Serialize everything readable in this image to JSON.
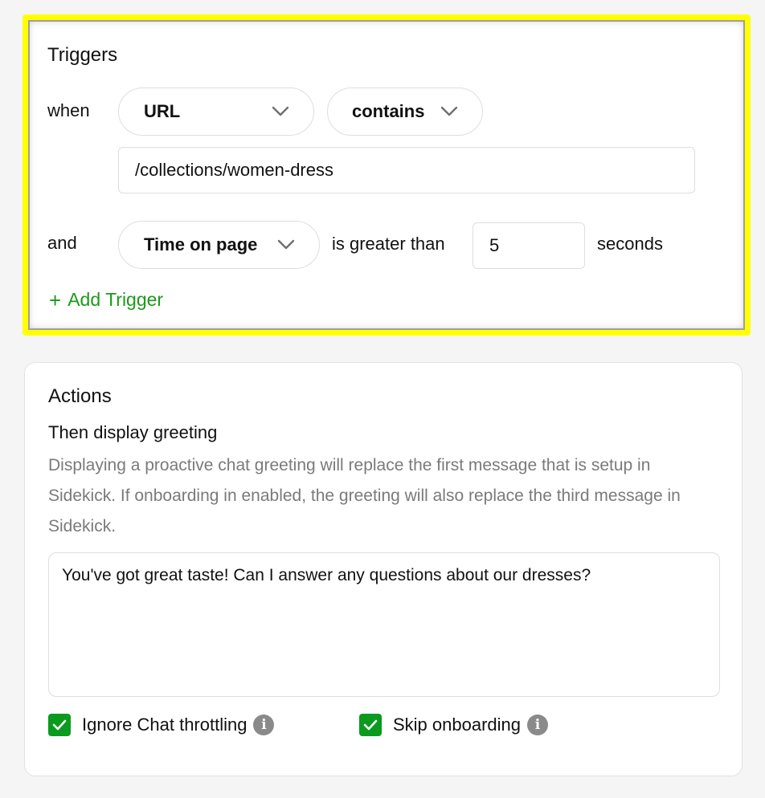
{
  "triggers": {
    "title": "Triggers",
    "when_label": "when",
    "field_select": "URL",
    "operator_select": "contains",
    "url_value": "/collections/women-dress",
    "and_label": "and",
    "metric_select": "Time on page",
    "comparison_text": "is greater than",
    "time_value": "5",
    "unit_text": "seconds",
    "add_trigger": "Add Trigger",
    "add_icon": "+"
  },
  "actions": {
    "title": "Actions",
    "subtitle": "Then display greeting",
    "description": "Displaying a proactive chat greeting will replace the first message that is setup in Sidekick. If onboarding in enabled, the greeting will also replace the third message in Sidekick.",
    "greeting_text": "You've got great taste! Can I answer any questions about our dresses?",
    "checkboxes": [
      {
        "label": "Ignore Chat throttling",
        "checked": true
      },
      {
        "label": "Skip onboarding",
        "checked": true
      }
    ],
    "info_glyph": "i"
  },
  "colors": {
    "highlight": "#ffff00",
    "accent_green": "#1a9a1a",
    "checkbox_green": "#0a9a1e",
    "muted_text": "#7a7a7a"
  }
}
